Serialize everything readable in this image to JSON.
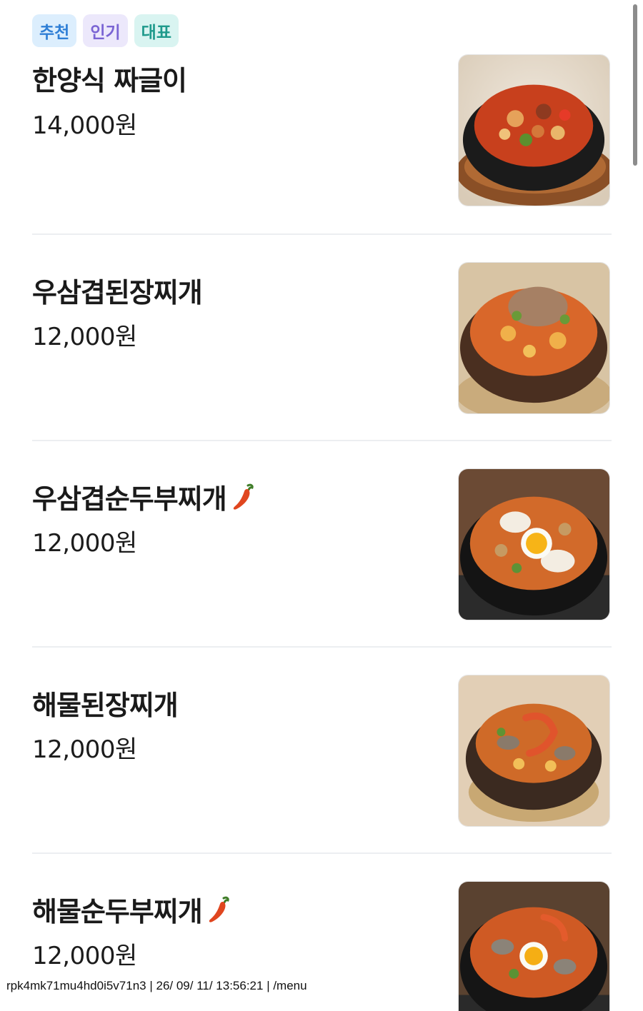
{
  "tags": [
    "추천",
    "인기",
    "대표"
  ],
  "menu": [
    {
      "name": "한양식 짜글이",
      "price": "14,000원",
      "spicy": false,
      "image": "jjageuli-photo"
    },
    {
      "name": "우삼겹된장찌개",
      "price": "12,000원",
      "spicy": false,
      "image": "doenjang-stew-photo"
    },
    {
      "name": "우삼겹순두부찌개",
      "price": "12,000원",
      "spicy": true,
      "image": "soft-tofu-stew-photo"
    },
    {
      "name": "해물된장찌개",
      "price": "12,000원",
      "spicy": false,
      "image": "seafood-doenjang-photo"
    },
    {
      "name": "해물순두부찌개",
      "price": "12,000원",
      "spicy": true,
      "image": "seafood-tofu-stew-photo"
    }
  ],
  "footer": {
    "text": "rpk4mk71mu4hd0i5v71n3 | 26/ 09/ 11/ 13:56:21 | /menu"
  },
  "colors": {
    "tag_blue": "#2f7fd6",
    "tag_purple": "#7a64d4",
    "tag_teal": "#1f9a8c",
    "chili": "#e0461f"
  },
  "icons": {
    "spicy": "chili-pepper-icon"
  }
}
